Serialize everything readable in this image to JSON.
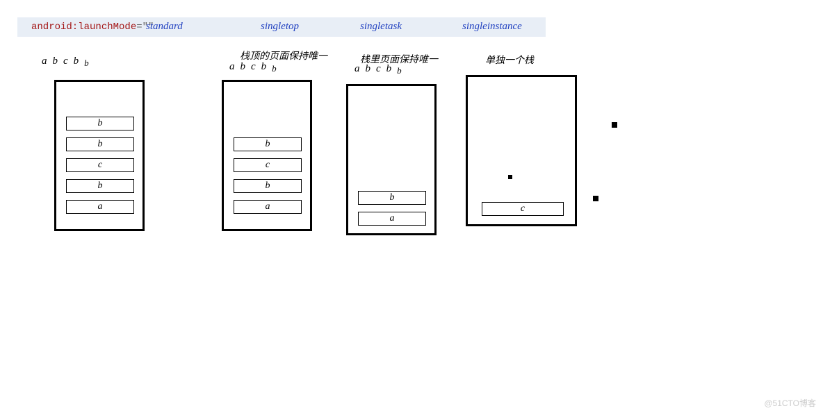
{
  "code": {
    "attr": "android:launchMode",
    "eq": "=\"\""
  },
  "modes": {
    "standard": "standard",
    "singletop": "singletop",
    "singletask": "singletask",
    "singleinstance": "singleinstance"
  },
  "subtitles": {
    "singletop": "栈顶的页面保持唯一",
    "singletask": "栈里页面保持唯一",
    "singleinstance": "单独一个栈"
  },
  "sequence": {
    "main": "abcb",
    "last": "b"
  },
  "stacks": {
    "standard": [
      "b",
      "b",
      "c",
      "b",
      "a"
    ],
    "singletop": [
      "b",
      "c",
      "b",
      "a"
    ],
    "singletask": [
      "b",
      "a"
    ],
    "singleinstance": [
      "c"
    ]
  },
  "watermark": "@51CTO博客"
}
